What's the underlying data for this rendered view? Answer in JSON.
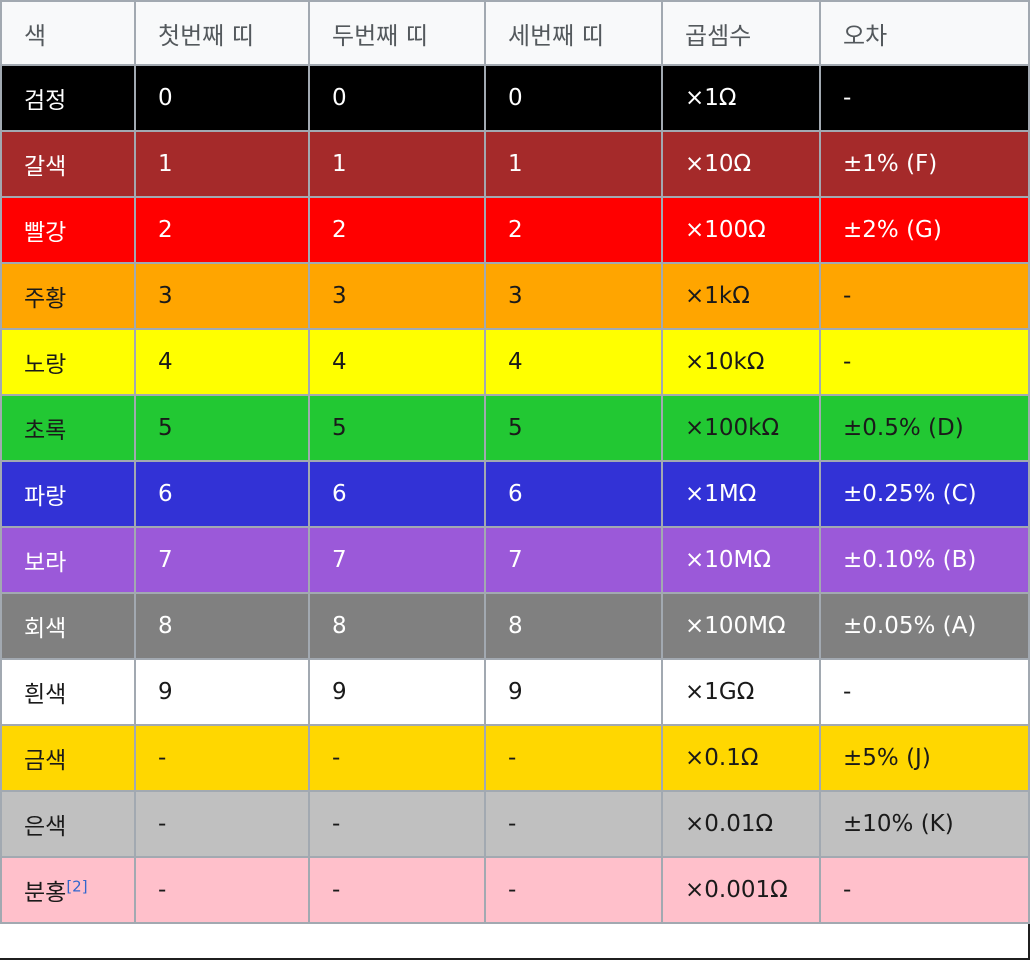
{
  "headers": [
    "색",
    "첫번째 띠",
    "두번째 띠",
    "세번째 띠",
    "곱셈수",
    "오차"
  ],
  "rows": [
    {
      "color": "검정",
      "band1": "0",
      "band2": "0",
      "band3": "0",
      "multiplier": "×1Ω",
      "tolerance": "-",
      "bg": "#000000",
      "fg": "#ffffff"
    },
    {
      "color": "갈색",
      "band1": "1",
      "band2": "1",
      "band3": "1",
      "multiplier": "×10Ω",
      "tolerance": "±1% (F)",
      "bg": "#a52a2a",
      "fg": "#ffffff"
    },
    {
      "color": "빨강",
      "band1": "2",
      "band2": "2",
      "band3": "2",
      "multiplier": "×100Ω",
      "tolerance": "±2% (G)",
      "bg": "#ff0000",
      "fg": "#ffffff"
    },
    {
      "color": "주황",
      "band1": "3",
      "band2": "3",
      "band3": "3",
      "multiplier": "×1kΩ",
      "tolerance": "-",
      "bg": "#ffa500",
      "fg": "#1a1a1a"
    },
    {
      "color": "노랑",
      "band1": "4",
      "band2": "4",
      "band3": "4",
      "multiplier": "×10kΩ",
      "tolerance": "-",
      "bg": "#ffff00",
      "fg": "#1a1a1a"
    },
    {
      "color": "초록",
      "band1": "5",
      "band2": "5",
      "band3": "5",
      "multiplier": "×100kΩ",
      "tolerance": "±0.5% (D)",
      "bg": "#22c833",
      "fg": "#1a1a1a"
    },
    {
      "color": "파랑",
      "band1": "6",
      "band2": "6",
      "band3": "6",
      "multiplier": "×1MΩ",
      "tolerance": "±0.25% (C)",
      "bg": "#3232d6",
      "fg": "#ffffff"
    },
    {
      "color": "보라",
      "band1": "7",
      "band2": "7",
      "band3": "7",
      "multiplier": "×10MΩ",
      "tolerance": "±0.10% (B)",
      "bg": "#9b59d9",
      "fg": "#ffffff"
    },
    {
      "color": "회색",
      "band1": "8",
      "band2": "8",
      "band3": "8",
      "multiplier": "×100MΩ",
      "tolerance": "±0.05% (A)",
      "bg": "#808080",
      "fg": "#ffffff"
    },
    {
      "color": "흰색",
      "band1": "9",
      "band2": "9",
      "band3": "9",
      "multiplier": "×1GΩ",
      "tolerance": "-",
      "bg": "#ffffff",
      "fg": "#1a1a1a"
    },
    {
      "color": "금색",
      "band1": "-",
      "band2": "-",
      "band3": "-",
      "multiplier": "×0.1Ω",
      "tolerance": "±5% (J)",
      "bg": "#ffd700",
      "fg": "#1a1a1a"
    },
    {
      "color": "은색",
      "band1": "-",
      "band2": "-",
      "band3": "-",
      "multiplier": "×0.01Ω",
      "tolerance": "±10% (K)",
      "bg": "#c0c0c0",
      "fg": "#1a1a1a"
    },
    {
      "color": "분홍",
      "ref": "[2]",
      "band1": "-",
      "band2": "-",
      "band3": "-",
      "multiplier": "×0.001Ω",
      "tolerance": "-",
      "bg": "#ffc0cb",
      "fg": "#1a1a1a"
    }
  ]
}
